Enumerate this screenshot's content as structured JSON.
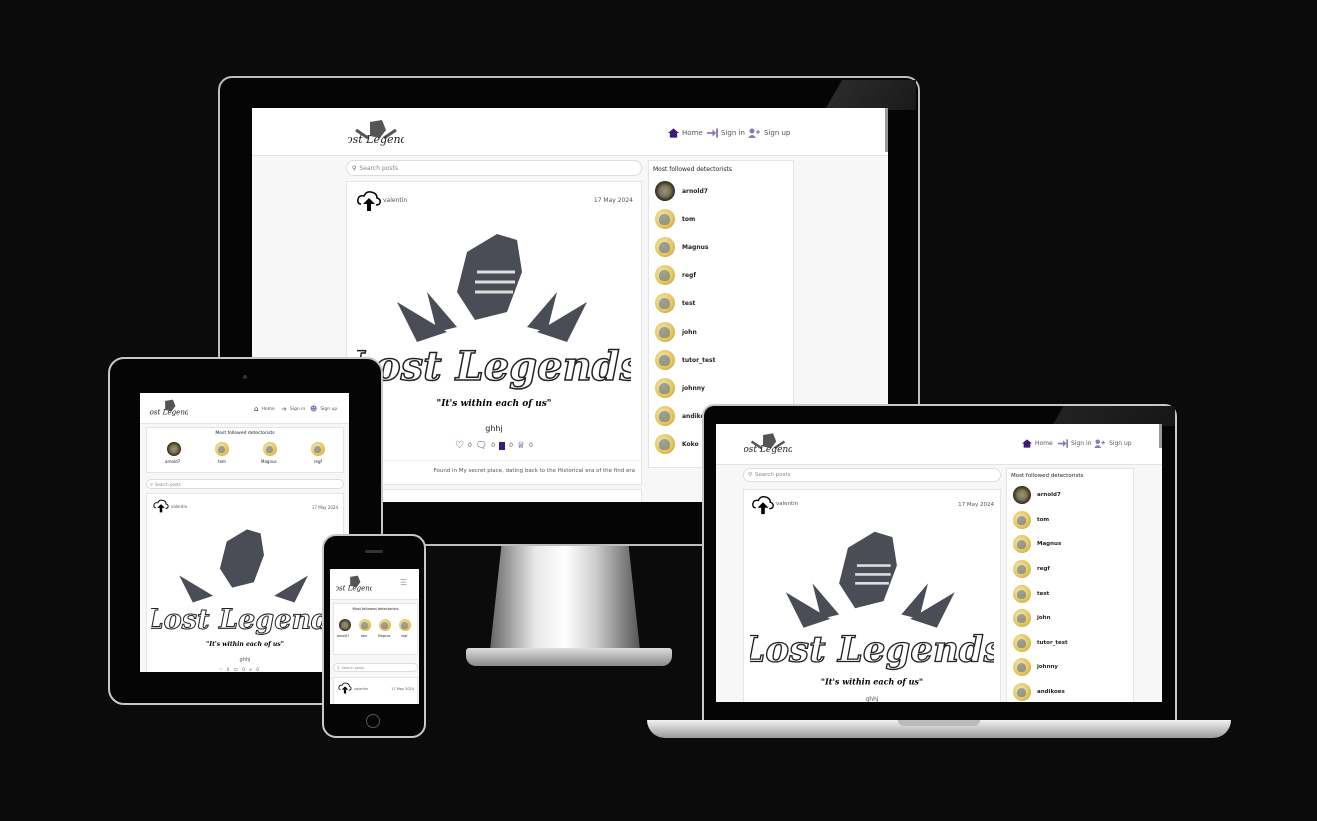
{
  "brand": {
    "logo_title": "Lost Legends",
    "logo_tagline": "\"It's within each of us\""
  },
  "nav": {
    "home": "Home",
    "signin": "Sign in",
    "signup": "Sign up"
  },
  "search": {
    "placeholder": "Search posts"
  },
  "sidebar": {
    "title": "Most followed detectorists",
    "users": [
      "arnold7",
      "tom",
      "Magnus",
      "regf",
      "test",
      "john",
      "tutor_test",
      "johnny",
      "andikoes",
      "Koko"
    ]
  },
  "post": {
    "author": "valentin",
    "date": "17 May 2024",
    "title": "ghhj",
    "likes": "0",
    "comments": "0",
    "bookmarks": "0",
    "crowns": "0",
    "description": "Found in My secret place, dating back to the Historical era of the find era"
  },
  "mobile_users": [
    "arnold7",
    "tom",
    "Magnus",
    "regf"
  ],
  "colors": {
    "accent": "#3b1b75",
    "background": "#0b0b0b",
    "page": "#f7f7f7"
  }
}
